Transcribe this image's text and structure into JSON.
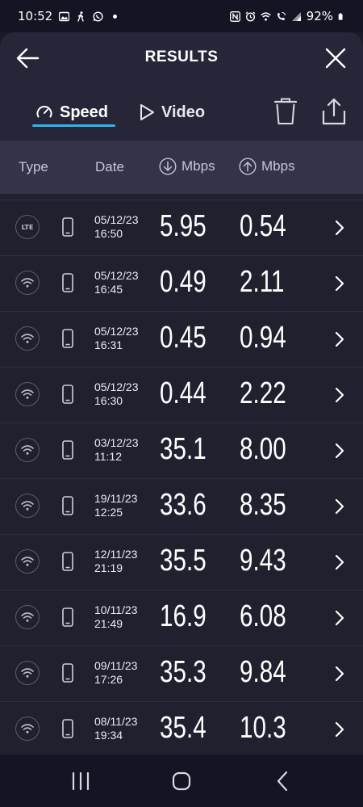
{
  "status_bar": {
    "time": "10:52",
    "battery": "92%",
    "icons_left": [
      "gallery-icon",
      "walk-icon",
      "whatsapp-icon",
      "dot-icon"
    ],
    "icons_right": [
      "nfc-icon",
      "alarm-icon",
      "wifi-icon",
      "wifi-call-icon",
      "signal-icon",
      "battery-icon"
    ]
  },
  "header": {
    "title": "RESULTS",
    "back_icon": "arrow-left-icon",
    "close_icon": "close-icon"
  },
  "tabs": [
    {
      "label": "Speed",
      "icon": "speedometer-icon",
      "selected": true
    },
    {
      "label": "Video",
      "icon": "play-icon",
      "selected": false
    }
  ],
  "toolbar": {
    "delete_icon": "trash-icon",
    "share_icon": "share-icon"
  },
  "columns": {
    "type": "Type",
    "date": "Date",
    "download": "Mbps",
    "upload": "Mbps",
    "download_icon": "download-arrow-icon",
    "upload_icon": "upload-arrow-icon"
  },
  "results": [
    {
      "type": "LTE",
      "date": "05/12/23",
      "time": "16:50",
      "download": "5.95",
      "upload": "0.54"
    },
    {
      "type": "wifi",
      "date": "05/12/23",
      "time": "16:45",
      "download": "0.49",
      "upload": "2.11"
    },
    {
      "type": "wifi",
      "date": "05/12/23",
      "time": "16:31",
      "download": "0.45",
      "upload": "0.94"
    },
    {
      "type": "wifi",
      "date": "05/12/23",
      "time": "16:30",
      "download": "0.44",
      "upload": "2.22"
    },
    {
      "type": "wifi",
      "date": "03/12/23",
      "time": "11:12",
      "download": "35.1",
      "upload": "8.00"
    },
    {
      "type": "wifi",
      "date": "19/11/23",
      "time": "12:25",
      "download": "33.6",
      "upload": "8.35"
    },
    {
      "type": "wifi",
      "date": "12/11/23",
      "time": "21:19",
      "download": "35.5",
      "upload": "9.43"
    },
    {
      "type": "wifi",
      "date": "10/11/23",
      "time": "21:49",
      "download": "16.9",
      "upload": "6.08"
    },
    {
      "type": "wifi",
      "date": "09/11/23",
      "time": "17:26",
      "download": "35.3",
      "upload": "9.84"
    },
    {
      "type": "wifi",
      "date": "08/11/23",
      "time": "19:34",
      "download": "35.4",
      "upload": "10.3"
    }
  ],
  "navbar": {
    "recents_icon": "recents-icon",
    "home_icon": "home-icon",
    "back_icon": "nav-back-icon"
  },
  "colors": {
    "accent": "#2fb5ee",
    "background": "#20202f",
    "header": "#262638",
    "column_header": "#33334a"
  }
}
